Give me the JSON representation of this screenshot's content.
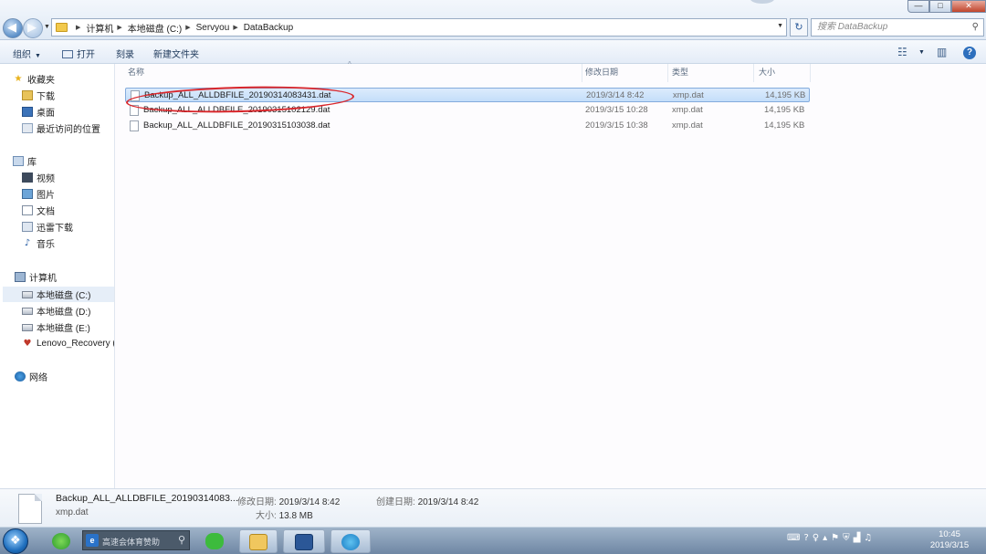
{
  "window": {
    "breadcrumb": [
      "计算机",
      "本地磁盘 (C:)",
      "Servyou",
      "DataBackup"
    ],
    "search_placeholder": "搜索 DataBackup"
  },
  "toolbar": {
    "organize": "组织",
    "open": "打开",
    "burn": "刻录",
    "new_folder": "新建文件夹"
  },
  "navpane": {
    "favorites": "收藏夹",
    "downloads": "下载",
    "desktop": "桌面",
    "recent": "最近访问的位置",
    "libraries": "库",
    "videos": "视频",
    "pictures": "图片",
    "documents": "文档",
    "thunder": "迅雷下载",
    "music": "音乐",
    "computer": "计算机",
    "drive_c": "本地磁盘 (C:)",
    "drive_d": "本地磁盘 (D:)",
    "drive_e": "本地磁盘 (E:)",
    "lenovo": "Lenovo_Recovery (",
    "network": "网络"
  },
  "columns": {
    "name": "名称",
    "modified": "修改日期",
    "type": "类型",
    "size": "大小"
  },
  "files": [
    {
      "name": "Backup_ALL_ALLDBFILE_20190314083431.dat",
      "modified": "2019/3/14 8:42",
      "type": "xmp.dat",
      "size": "14,195 KB"
    },
    {
      "name": "Backup_ALL_ALLDBFILE_20190315102129.dat",
      "modified": "2019/3/15 10:28",
      "type": "xmp.dat",
      "size": "14,195 KB"
    },
    {
      "name": "Backup_ALL_ALLDBFILE_20190315103038.dat",
      "modified": "2019/3/15 10:38",
      "type": "xmp.dat",
      "size": "14,195 KB"
    }
  ],
  "details": {
    "name": "Backup_ALL_ALLDBFILE_20190314083...",
    "type": "xmp.dat",
    "modified_label": "修改日期:",
    "modified_value": "2019/3/14 8:42",
    "created_label": "创建日期:",
    "created_value": "2019/3/14 8:42",
    "size_label": "大小:",
    "size_value": "13.8 MB"
  },
  "taskbar": {
    "search_text": "高速会体育赞助",
    "time": "10:45",
    "date": "2019/3/15"
  },
  "colors": {
    "highlight": "#d9262b",
    "selection": "#c4defa"
  }
}
